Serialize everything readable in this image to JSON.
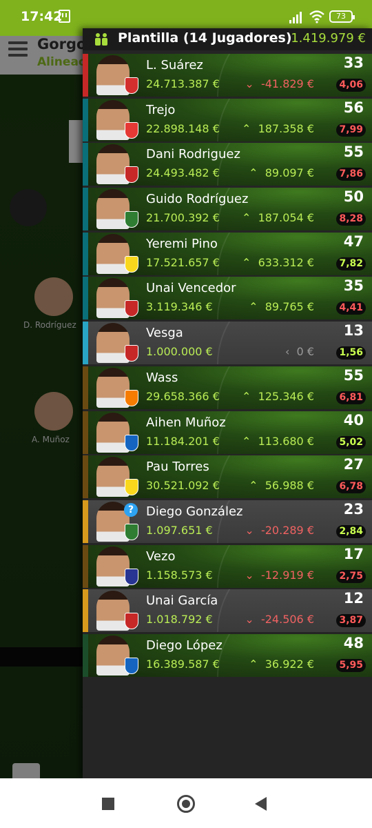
{
  "status_bar": {
    "time": "17:42",
    "battery": "73"
  },
  "background_app": {
    "title": "Gorgo",
    "subtitle": "Alineac",
    "player_labels": [
      "D. Rodríguez",
      "A. Muñoz"
    ]
  },
  "drawer": {
    "title": "Plantilla (14 Jugadores)",
    "team_value": "1.419.979 €",
    "players": [
      {
        "name": "L. Suárez",
        "price": "24.713.387 €",
        "change": "-41.829 €",
        "trend": "down",
        "points": "33",
        "average": "4,06",
        "avg_color": "red",
        "bar_color": "#c62828",
        "crest_color": "#d32f2f",
        "grey": false
      },
      {
        "name": "Trejo",
        "price": "22.898.148 €",
        "change": "187.358 €",
        "trend": "up",
        "points": "56",
        "average": "7,99",
        "avg_color": "red",
        "bar_color": "#0a6f78",
        "crest_color": "#e53935",
        "grey": false
      },
      {
        "name": "Dani Rodriguez",
        "price": "24.493.482 €",
        "change": "89.097 €",
        "trend": "up",
        "points": "55",
        "average": "7,86",
        "avg_color": "red",
        "bar_color": "#0a6f78",
        "crest_color": "#c62828",
        "grey": false
      },
      {
        "name": "Guido Rodríguez",
        "price": "21.700.392 €",
        "change": "187.054 €",
        "trend": "up",
        "points": "50",
        "average": "8,28",
        "avg_color": "red",
        "bar_color": "#0a6f78",
        "crest_color": "#2e7d32",
        "grey": false
      },
      {
        "name": "Yeremi Pino",
        "price": "17.521.657 €",
        "change": "633.312 €",
        "trend": "up",
        "points": "47",
        "average": "7,82",
        "avg_color": "green",
        "bar_color": "#0a6f78",
        "crest_color": "#f9d71c",
        "grey": false
      },
      {
        "name": "Unai Vencedor",
        "price": "3.119.346 €",
        "change": "89.765 €",
        "trend": "up",
        "points": "35",
        "average": "4,41",
        "avg_color": "red",
        "bar_color": "#0a6f78",
        "crest_color": "#c62828",
        "grey": false
      },
      {
        "name": "Vesga",
        "price": "1.000.000 €",
        "change": "0 €",
        "trend": "flat",
        "points": "13",
        "average": "1,56",
        "avg_color": "green",
        "bar_color": "#2aa4c4",
        "crest_color": "#c62828",
        "grey": true
      },
      {
        "name": "Wass",
        "price": "29.658.366 €",
        "change": "125.346 €",
        "trend": "up",
        "points": "55",
        "average": "6,81",
        "avg_color": "red",
        "bar_color": "#6b4a12",
        "crest_color": "#f57c00",
        "grey": false
      },
      {
        "name": "Aihen Muñoz",
        "price": "11.184.201 €",
        "change": "113.680 €",
        "trend": "up",
        "points": "40",
        "average": "5,02",
        "avg_color": "green",
        "bar_color": "#6b4a12",
        "crest_color": "#1565c0",
        "grey": false
      },
      {
        "name": "Pau Torres",
        "price": "30.521.092 €",
        "change": "56.988 €",
        "trend": "up",
        "points": "27",
        "average": "6,78",
        "avg_color": "red",
        "bar_color": "#6b4a12",
        "crest_color": "#f9d71c",
        "grey": false
      },
      {
        "name": "Diego González",
        "price": "1.097.651 €",
        "change": "-20.289 €",
        "trend": "down",
        "points": "23",
        "average": "2,84",
        "avg_color": "green",
        "bar_color": "#d89a1c",
        "crest_color": "#2e7d32",
        "grey": true,
        "badge": "?"
      },
      {
        "name": "Vezo",
        "price": "1.158.573 €",
        "change": "-12.919 €",
        "trend": "down",
        "points": "17",
        "average": "2,75",
        "avg_color": "red",
        "bar_color": "#6b4a12",
        "crest_color": "#283593",
        "grey": false
      },
      {
        "name": "Unai García",
        "price": "1.018.792 €",
        "change": "-24.506 €",
        "trend": "down",
        "points": "12",
        "average": "3,87",
        "avg_color": "red",
        "bar_color": "#d89a1c",
        "crest_color": "#c62828",
        "grey": true
      },
      {
        "name": "Diego López",
        "price": "16.389.587 €",
        "change": "36.922 €",
        "trend": "up",
        "points": "48",
        "average": "5,95",
        "avg_color": "red",
        "bar_color": "#1b4d2a",
        "crest_color": "#1565c0",
        "grey": false
      }
    ]
  }
}
